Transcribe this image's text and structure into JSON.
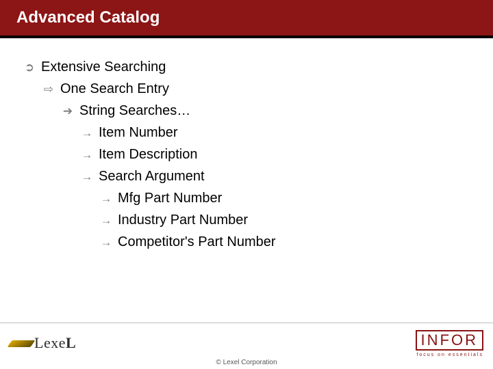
{
  "title": "Advanced Catalog",
  "bullets": {
    "l1": "Extensive Searching",
    "l2": "One Search Entry",
    "l3": "String Searches…",
    "l4a": "Item Number",
    "l4b": "Item Description",
    "l4c": "Search Argument",
    "l5a": "Mfg Part Number",
    "l5b": "Industry Part Number",
    "l5c": "Competitor's Part Number"
  },
  "glyphs": {
    "g1": "➲",
    "g2": "⇨",
    "g3": "➔",
    "g4": "→",
    "g5": "→"
  },
  "footer": {
    "copyright": "© Lexel Corporation",
    "left_logo_text": "Lexe",
    "left_logo_last": "L",
    "right_logo_text": "INFOR",
    "right_tagline": "focus on essentials"
  }
}
